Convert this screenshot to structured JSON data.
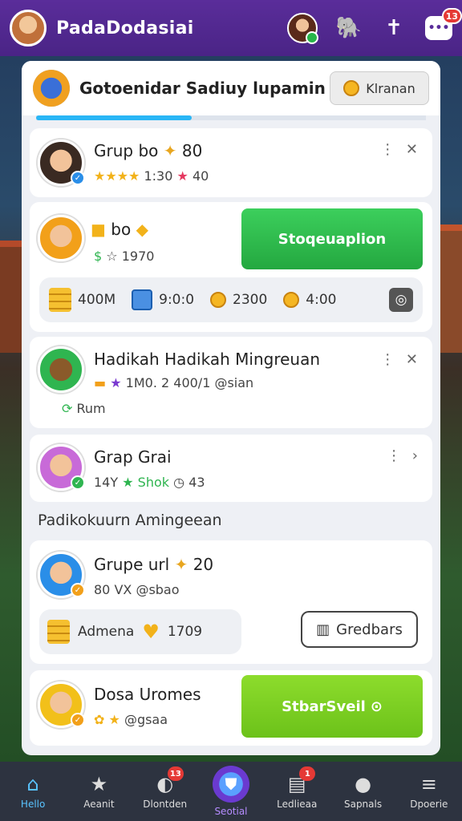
{
  "app": {
    "title": "PadaDodasiai"
  },
  "topbar": {
    "chat_badge": "13"
  },
  "panel": {
    "title": "Gotoenidar Sadiuy lupamin",
    "head_button": "Klranan",
    "progress": 0.4
  },
  "cards": [
    {
      "name": "Grup bo",
      "level": "80",
      "stars_value": "1:30",
      "extra": "40"
    },
    {
      "name": "bo",
      "sub_value": "1970",
      "button": "Stoqeuaplion",
      "stats": [
        "400M",
        "9:0:0",
        "2300",
        "4:00"
      ]
    },
    {
      "name": "Hadikah Hadikah Mingreuan",
      "sub": "1M0. 2 400/1 @sian",
      "tag": "Rum"
    },
    {
      "name": "Grap Grai",
      "sub": "14Y",
      "sub2": "Shok",
      "sub3": "43"
    }
  ],
  "section_label": "Padikokuurn Amingeean",
  "cards2": [
    {
      "name": "Grupe url",
      "level": "20",
      "sub": "80 VX @sbao",
      "item": "Admena",
      "item_value": "1709",
      "button": "Gredbars"
    },
    {
      "name": "Dosa Uromes",
      "sub": "@gsaa",
      "button": "StbarSveil"
    }
  ],
  "nav": [
    {
      "label": "Hello",
      "icon": "home-icon"
    },
    {
      "label": "Aeanit",
      "icon": "star-icon"
    },
    {
      "label": "Dlontden",
      "icon": "moon-icon",
      "badge": "13"
    },
    {
      "label": "Seotial",
      "icon": "shield-icon"
    },
    {
      "label": "Ledlieaa",
      "icon": "cards-icon",
      "badge": "1"
    },
    {
      "label": "Sapnals",
      "icon": "user-icon"
    },
    {
      "label": "Dpoerie",
      "icon": "menu-icon"
    }
  ],
  "colors": {
    "purple": "#5a2d9a",
    "green": "#2fb550",
    "lime": "#7bd12a",
    "accent": "#29b6f6"
  }
}
